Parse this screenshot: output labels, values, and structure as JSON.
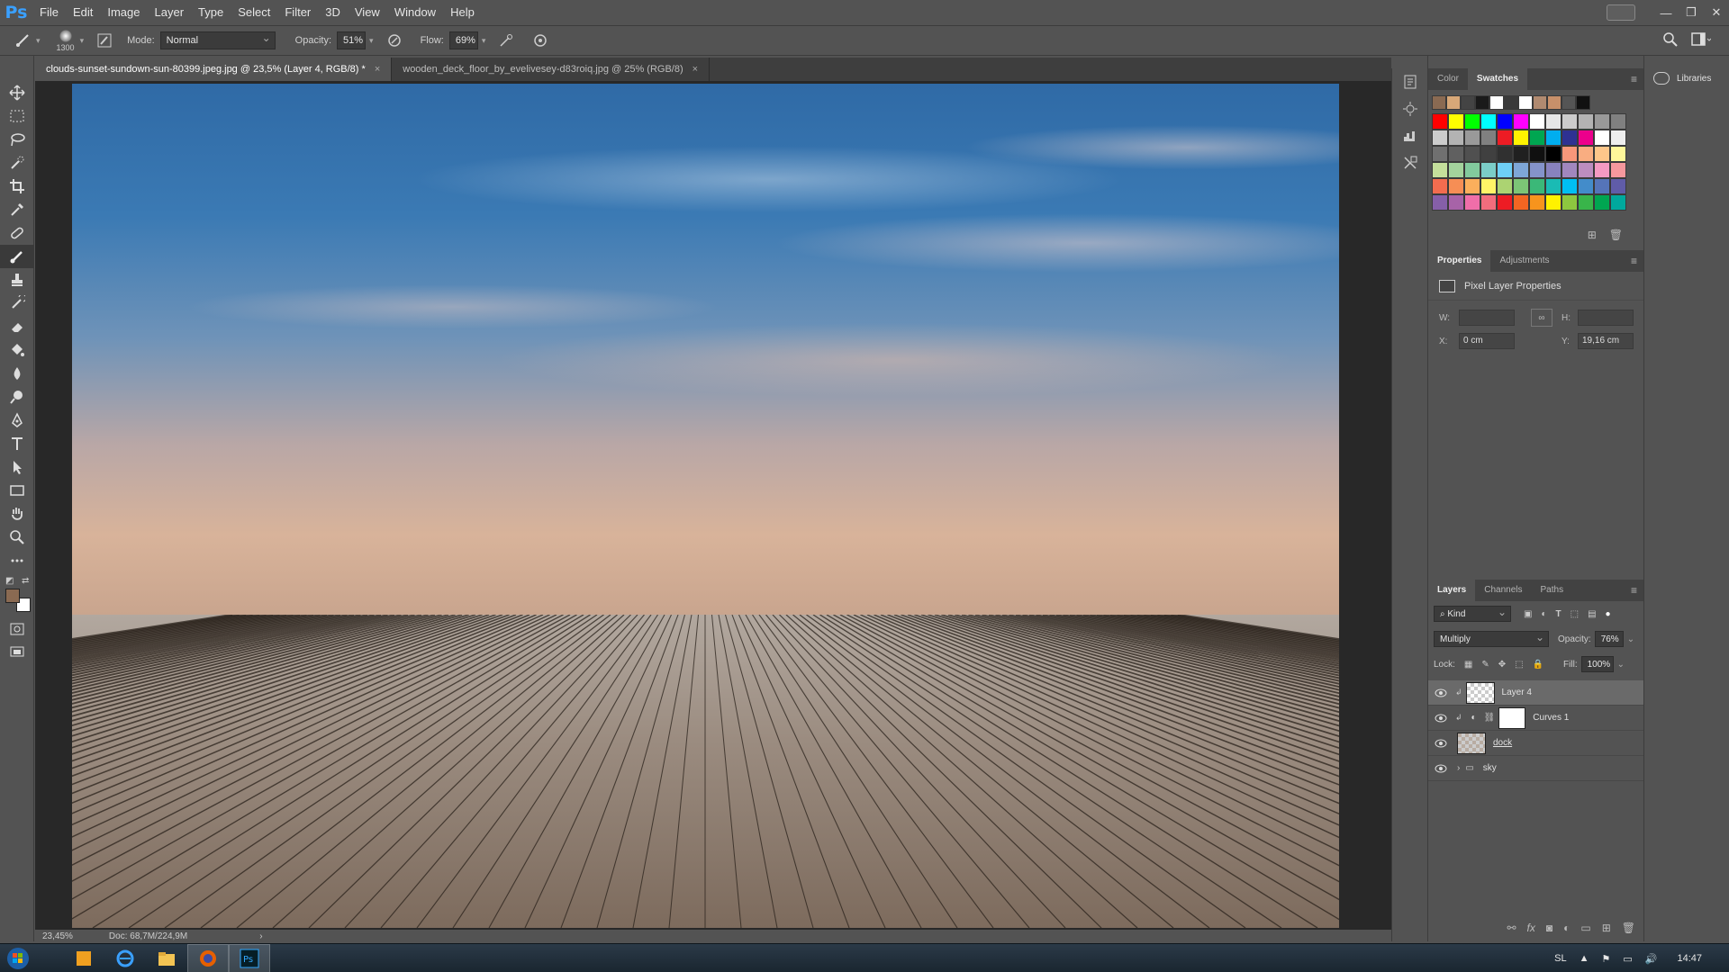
{
  "app": {
    "logo": "Ps"
  },
  "menu": [
    "File",
    "Edit",
    "Image",
    "Layer",
    "Type",
    "Select",
    "Filter",
    "3D",
    "View",
    "Window",
    "Help"
  ],
  "options": {
    "brush_size": "1300",
    "mode_label": "Mode:",
    "mode_value": "Normal",
    "opacity_label": "Opacity:",
    "opacity_value": "51%",
    "flow_label": "Flow:",
    "flow_value": "69%"
  },
  "tools": [
    "move-tool",
    "marquee-tool",
    "lasso-tool",
    "quick-select-tool",
    "crop-tool",
    "eyedropper-tool",
    "healing-brush-tool",
    "brush-tool",
    "stamp-tool",
    "history-brush-tool",
    "eraser-tool",
    "paint-bucket-tool",
    "blur-tool",
    "dodge-tool",
    "pen-tool",
    "type-tool",
    "path-select-tool",
    "rectangle-tool",
    "hand-tool",
    "zoom-tool",
    "more-tools"
  ],
  "colors": {
    "foreground": "#8a6a52",
    "background": "#ffffff",
    "accent": "#3aa0ff"
  },
  "documents": [
    {
      "title": "clouds-sunset-sundown-sun-80399.jpeg.jpg @ 23,5% (Layer 4, RGB/8) *",
      "close": "×",
      "active": true
    },
    {
      "title": "wooden_deck_floor_by_evelivesey-d83roiq.jpg @ 25% (RGB/8)",
      "close": "×",
      "active": false
    }
  ],
  "status": {
    "zoom": "23,45%",
    "doc": "Doc: 68,7M/224,9M",
    "arrow": "›"
  },
  "color_panel": {
    "tabs": [
      "Color",
      "Swatches"
    ],
    "recent": [
      "#8a6a52",
      "#d8a878",
      "#444444",
      "#1a1a1a",
      "#ffffff",
      "#3a3a3a",
      "#ffffff",
      "#b08a70",
      "#c8906a",
      "#555555",
      "#111111"
    ],
    "grid": [
      "#ff0000",
      "#ffff00",
      "#00ff00",
      "#00ffff",
      "#0000ff",
      "#ff00ff",
      "#ffffff",
      "#e6e6e6",
      "#cccccc",
      "#b3b3b3",
      "#999999",
      "#808080",
      "#cccccc",
      "#b3b3b3",
      "#999999",
      "#808080",
      "#ed1c24",
      "#fff200",
      "#00a651",
      "#00aeef",
      "#2e3192",
      "#ec008c",
      "#ffffff",
      "#eeeeee",
      "#707070",
      "#606060",
      "#505050",
      "#404040",
      "#303030",
      "#202020",
      "#101010",
      "#000000",
      "#f7977a",
      "#f9ad81",
      "#fdc68a",
      "#fff79a",
      "#c4df9b",
      "#a3d39c",
      "#82ca9d",
      "#7bcdc8",
      "#6ecff6",
      "#7ea7d8",
      "#8493ca",
      "#8882be",
      "#a187be",
      "#bc8dbf",
      "#f49ac2",
      "#f6989d",
      "#f26c4f",
      "#f68e55",
      "#fbaf5c",
      "#fff467",
      "#acd372",
      "#7cc576",
      "#3bb878",
      "#1abbb4",
      "#00bff3",
      "#438cca",
      "#5574b9",
      "#605ca8",
      "#855fa8",
      "#a763a8",
      "#f06ea9",
      "#f26d7d",
      "#ed1c24",
      "#f26522",
      "#f7941d",
      "#fff200",
      "#8dc73f",
      "#39b54a",
      "#00a651",
      "#00a99d"
    ]
  },
  "properties": {
    "tabs": [
      "Properties",
      "Adjustments"
    ],
    "title": "Pixel Layer Properties",
    "w_label": "W:",
    "w_value": "",
    "h_label": "H:",
    "h_value": "",
    "x_label": "X:",
    "x_value": "0 cm",
    "y_label": "Y:",
    "y_value": "19,16 cm"
  },
  "layers": {
    "tabs": [
      "Layers",
      "Channels",
      "Paths"
    ],
    "kind": "Kind",
    "blend_mode": "Multiply",
    "opacity_label": "Opacity:",
    "opacity_value": "76%",
    "lock_label": "Lock:",
    "fill_label": "Fill:",
    "fill_value": "100%",
    "items": [
      {
        "name": "Layer 4",
        "active": true
      },
      {
        "name": "Curves 1",
        "active": false
      },
      {
        "name": "dock",
        "active": false
      },
      {
        "name": "sky",
        "active": false
      }
    ]
  },
  "libraries": {
    "label": "Libraries"
  },
  "taskbar": {
    "lang": "SL",
    "time": "14:47"
  }
}
